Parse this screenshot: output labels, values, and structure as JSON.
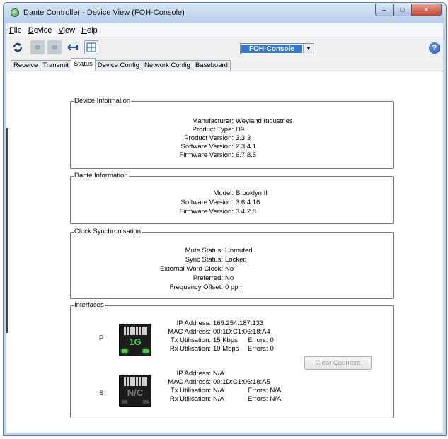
{
  "window": {
    "title": "Dante Controller - Device View (FOH-Console)",
    "controls": {
      "minimize": "–",
      "maximize": "□",
      "close": "✕"
    }
  },
  "menu": [
    {
      "label": "File",
      "mnemonic": "F",
      "rest": "ile"
    },
    {
      "label": "Device",
      "mnemonic": "D",
      "rest": "evice"
    },
    {
      "label": "View",
      "mnemonic": "V",
      "rest": "iew"
    },
    {
      "label": "Help",
      "mnemonic": "H",
      "rest": "elp"
    }
  ],
  "toolbar": {
    "icons": [
      "refresh-icon",
      "connect-icon",
      "identify-icon",
      "back-connect-icon",
      "grid-icon"
    ],
    "device_selected": "FOH-Console",
    "dropdown_arrow": "▼",
    "help_label": "?"
  },
  "tabs": [
    "Receive",
    "Transmit",
    "Status",
    "Device Config",
    "Network Config",
    "Baseboard"
  ],
  "active_tab": "Status",
  "device_info": {
    "title": "Device Information",
    "rows": [
      {
        "k": "Manufacturer:",
        "v": "Weyland Industries"
      },
      {
        "k": "Product Type:",
        "v": "D9"
      },
      {
        "k": "Product Version:",
        "v": "3.3.3"
      },
      {
        "k": "Software Version:",
        "v": "2.3.4.1"
      },
      {
        "k": "Firmware Version:",
        "v": "6.7.8.5"
      }
    ]
  },
  "dante_info": {
    "title": "Dante Information",
    "rows": [
      {
        "k": "Model:",
        "v": "Brooklyn II"
      },
      {
        "k": "Software Version:",
        "v": "3.6.4.16"
      },
      {
        "k": "Firmware Version:",
        "v": "3.4.2.8"
      }
    ]
  },
  "clock_sync": {
    "title": "Clock Synchronisation",
    "rows": [
      {
        "k": "Mute Status:",
        "v": "Unmuted"
      },
      {
        "k": "Sync Status:",
        "v": "Locked"
      },
      {
        "k": "External Word Clock:",
        "v": "No"
      },
      {
        "k": "Preferred:",
        "v": "No"
      },
      {
        "k": "Frequency Offset:",
        "v": "0 ppm"
      }
    ]
  },
  "interfaces": {
    "title": "Interfaces",
    "primary": {
      "label": "P",
      "port_speed": "1G",
      "ip_label": "IP Address:",
      "ip": "169.254.187.133",
      "mac_label": "MAC Address:",
      "mac": "00:1D:C1:06:18:A4",
      "tx_label": "Tx Utilisation:",
      "tx": "15 Kbps",
      "tx_err_label": "Errors:",
      "tx_err": "0",
      "rx_label": "Rx Utilisation:",
      "rx": "19 Mbps",
      "rx_err_label": "Errors:",
      "rx_err": "0"
    },
    "secondary": {
      "label": "S",
      "port_speed": "N/C",
      "ip_label": "IP Address:",
      "ip": "N/A",
      "mac_label": "MAC Address:",
      "mac": "00:1D:C1:06:18:A5",
      "tx_label": "Tx Utilisation:",
      "tx": "N/A",
      "tx_err_label": "Errors:",
      "tx_err": "N/A",
      "rx_label": "Rx Utilisation:",
      "rx": "N/A",
      "rx_err_label": "Errors:",
      "rx_err": "N/A"
    },
    "clear_counters": "Clear Counters"
  }
}
